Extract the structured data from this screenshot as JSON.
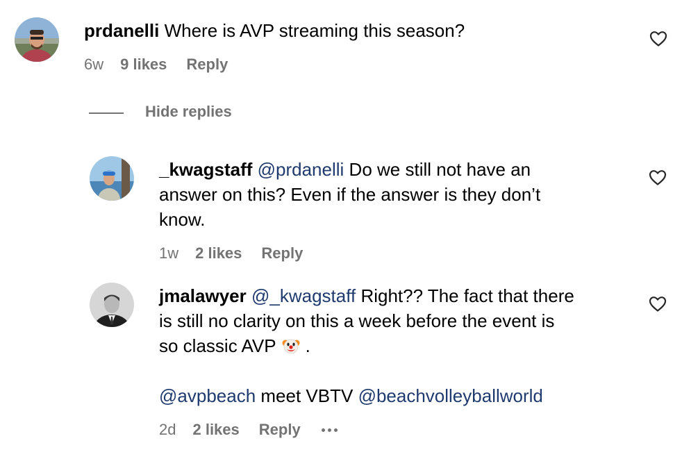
{
  "comments": [
    {
      "username": "prdanelli",
      "mention": "",
      "text": "Where is AVP streaming this season?",
      "time": "6w",
      "likes": "9 likes",
      "reply": "Reply"
    },
    {
      "username": "_kwagstaff",
      "mention": "@prdanelli",
      "line1": "Do we still not have an",
      "line2": "answer on this? Even if the answer is they don’t",
      "line3": "know.",
      "time": "1w",
      "likes": "2 likes",
      "reply": "Reply"
    },
    {
      "username": "jmalawyer",
      "mention": "@_kwagstaff",
      "line1": "Right?? The fact that there",
      "line2": "is still no clarity on this a week before the event is",
      "line3": "so classic AVP",
      "line3_end": ".",
      "mention2": "@avpbeach",
      "middle": "meet VBTV",
      "mention3": "@beachvolleyballworld",
      "time": "2d",
      "likes": "2 likes",
      "reply": "Reply"
    }
  ],
  "replies_toggle": "Hide replies",
  "icons": {
    "like": "heart-icon",
    "more": "more-options-icon",
    "emoji": "clown-face-emoji"
  }
}
